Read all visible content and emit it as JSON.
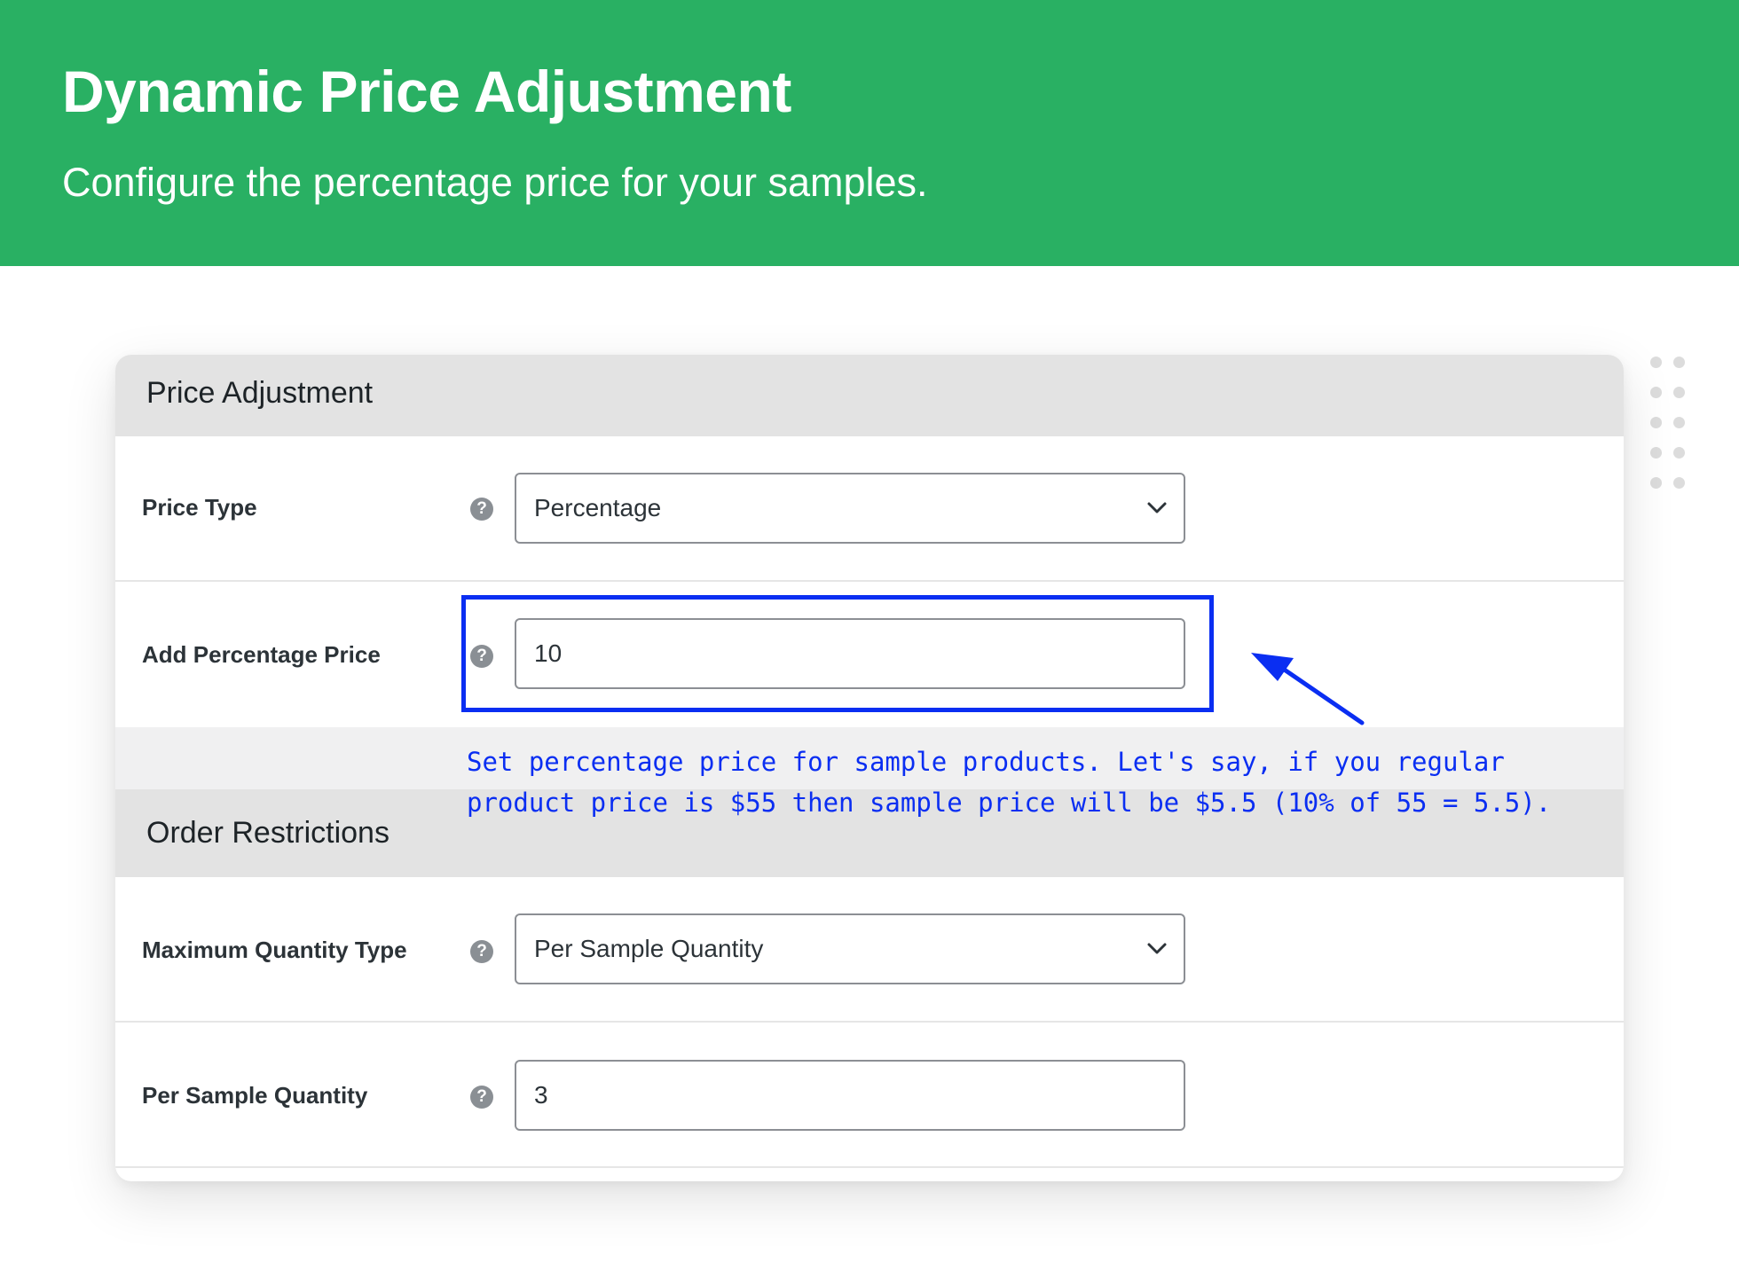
{
  "banner": {
    "title": "Dynamic Price Adjustment",
    "subtitle": "Configure the percentage price for your samples."
  },
  "sections": {
    "price_adjustment": {
      "title": "Price Adjustment",
      "rows": [
        {
          "label": "Price Type",
          "type": "select",
          "value": "Percentage",
          "help_icon": "question-mark-icon"
        },
        {
          "label": "Add Percentage Price",
          "type": "text",
          "value": "10",
          "help_icon": "question-mark-icon"
        }
      ]
    },
    "order_restrictions": {
      "title": "Order Restrictions",
      "rows": [
        {
          "label": "Maximum Quantity Type",
          "type": "select",
          "value": "Per Sample Quantity",
          "help_icon": "question-mark-icon"
        },
        {
          "label": "Per Sample Quantity",
          "type": "text",
          "value": "3",
          "help_icon": "question-mark-icon"
        }
      ]
    }
  },
  "annotation": {
    "text": "Set percentage price for sample products. Let's say, if you regular product price is $55 then sample price will be $5.5 (10% of 55 = 5.5)."
  },
  "colors": {
    "banner": "#29b063",
    "annotation": "#0a2ef2",
    "section_header": "#e3e3e3",
    "help_icon": "#8a8f94"
  },
  "help_glyph": "?"
}
